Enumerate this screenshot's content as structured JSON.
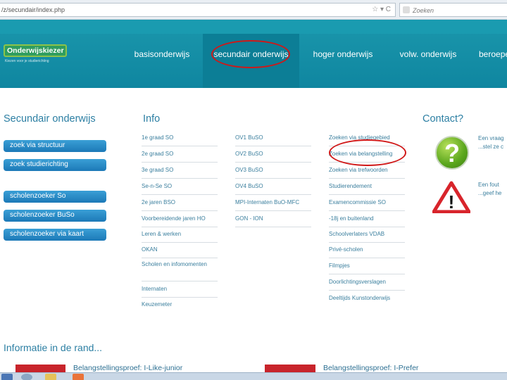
{
  "browser": {
    "url": "/z/secundair/index.php",
    "url_icons": "☆ ▾ C",
    "search_placeholder": "Zoeken"
  },
  "header": {
    "logo": "Onderwijskiezer",
    "logo_tagline": "Kiezen voor je studierichting",
    "nav": [
      "basisonderwijs",
      "secundair onderwijs",
      "hoger onderwijs",
      "volw. onderwijs",
      "beroepe"
    ]
  },
  "sidebar": {
    "title": "Secundair onderwijs",
    "buttons": [
      "zoek via structuur",
      "zoek studierichting",
      "scholenzoeker So",
      "scholenzoeker BuSo",
      "scholenzoeker via kaart"
    ]
  },
  "info": {
    "title": "Info",
    "col1": [
      "1e graad SO",
      "2e graad SO",
      "3e graad SO",
      "Se-n-Se SO",
      "2e jaren BSO",
      "Voorbereidende jaren HO",
      "Leren & werken",
      "OKAN",
      "Scholen en infomomenten",
      "Internaten",
      "Keuzemeter"
    ],
    "col2": [
      "OV1 BuSO",
      "OV2 BuSO",
      "OV3 BuSO",
      "OV4 BuSO",
      "MPI-Internaten BuO-MFC",
      "GON - ION"
    ],
    "col3": [
      "Zoeken via studiegebied",
      "Zoeken via belangstelling",
      "Zoeken via trefwoorden",
      "Studierendement",
      "Examencommissie SO",
      "-18j en buitenland",
      "Schoolverlaters VDAB",
      "Privé-scholen",
      "Filmpjes",
      "Doorlichtingsverslagen",
      "Deeltijds Kunstonderwijs"
    ]
  },
  "contact": {
    "title": "Contact?",
    "q1_line1": "Een vraag",
    "q1_line2": "...stel ze c",
    "q2_line1": "Een fout",
    "q2_line2": "...geef he",
    "q_mark": "?",
    "warn_mark": "!"
  },
  "footer": {
    "title": "Informatie in de rand...",
    "item1": "Belangstellingsproef: I-Like-junior",
    "item2": "Belangstellingsproef: I-Prefer"
  },
  "colors": {
    "header": "#1592a8",
    "button": "#2a8cc8",
    "link": "#3b7f9e",
    "annotation": "#d01818"
  }
}
